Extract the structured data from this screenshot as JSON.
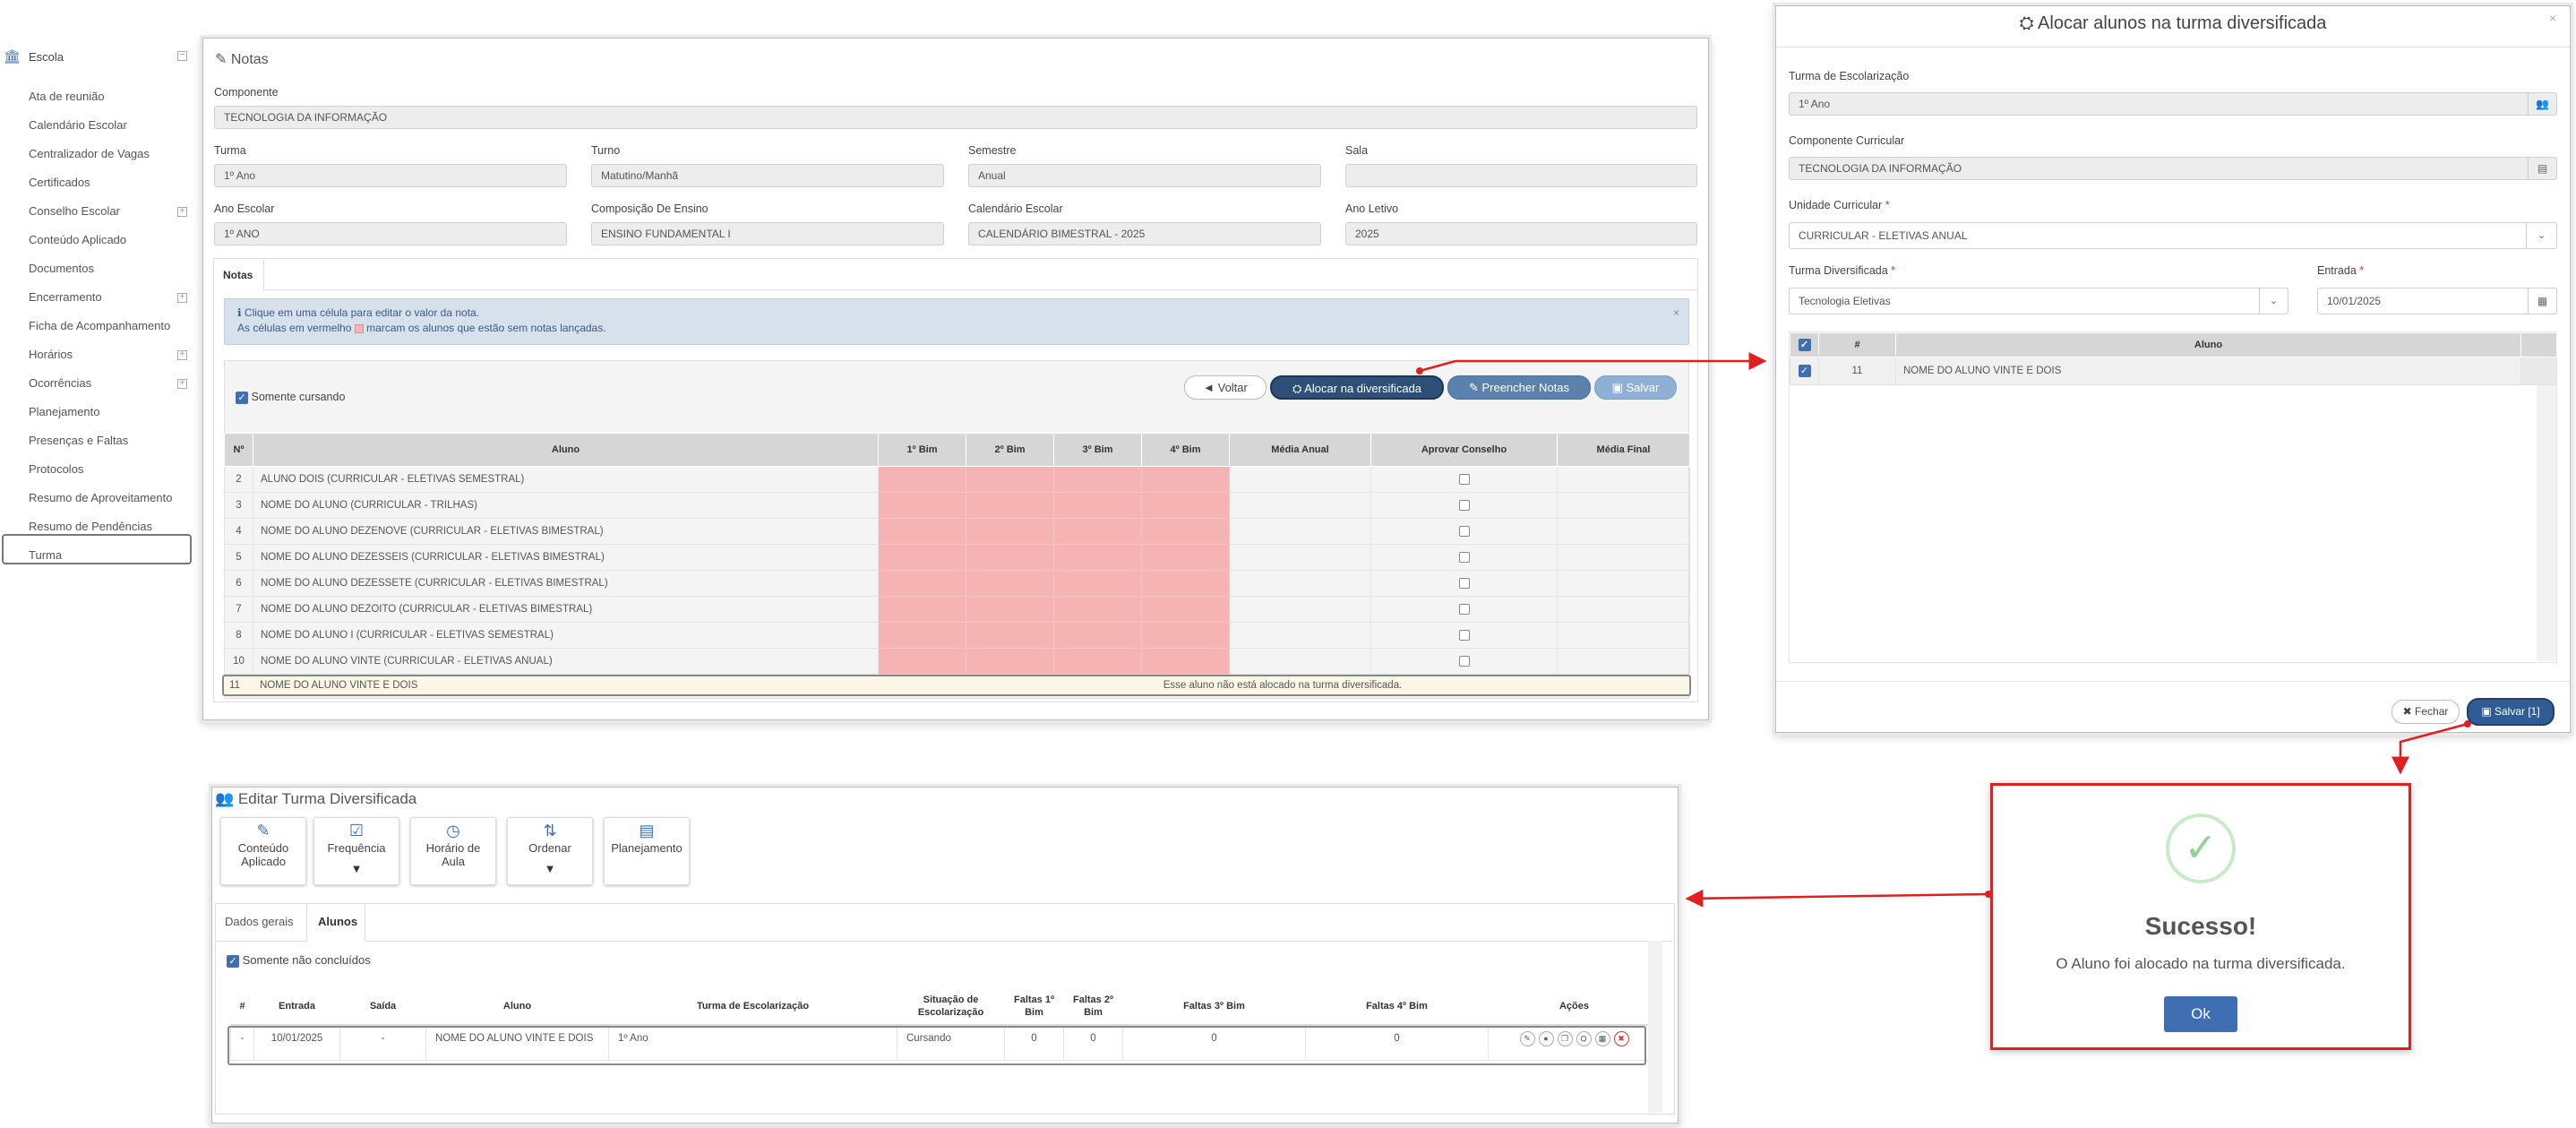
{
  "sidebar": {
    "title": "Escola",
    "items": [
      "Ata de reunião",
      "Calendário Escolar",
      "Centralizador de Vagas",
      "Certificados",
      "Conselho Escolar",
      "Conteúdo Aplicado",
      "Documentos",
      "Encerramento",
      "Ficha de Acompanhamento",
      "Horários",
      "Ocorrências",
      "Planejamento",
      "Presenças e Faltas",
      "Protocolos",
      "Resumo de Aproveitamento",
      "Resumo de Pendências",
      "Turma"
    ]
  },
  "notas": {
    "title": "Notas",
    "componente_label": "Componente",
    "componente": "TECNOLOGIA DA INFORMAÇÃO",
    "turma_label": "Turma",
    "turma": "1º Ano",
    "turno_label": "Turno",
    "turno": "Matutino/Manhã",
    "semestre_label": "Semestre",
    "semestre": "Anual",
    "sala_label": "Sala",
    "sala": "",
    "ano_escolar_label": "Ano Escolar",
    "ano_escolar": "1º ANO",
    "composicao_label": "Composição De Ensino",
    "composicao": "ENSINO FUNDAMENTAL I",
    "calendario_label": "Calendário Escolar",
    "calendario": "CALENDÁRIO BIMESTRAL - 2025",
    "ano_letivo_label": "Ano Letivo",
    "ano_letivo": "2025",
    "tab": "Notas",
    "info_line1": "Clique em uma célula para editar o valor da nota.",
    "info_line2a": "As células em vermelho",
    "info_line2b": "marcam os alunos que estão sem notas lançadas.",
    "somente_cursando": "Somente cursando",
    "btn_voltar": "Voltar",
    "btn_alocar": "Alocar na diversificada",
    "btn_preencher": "Preencher Notas",
    "btn_salvar": "Salvar",
    "headers": [
      "Nº",
      "Aluno",
      "1º Bim",
      "2º Bim",
      "3º Bim",
      "4º Bim",
      "Média Anual",
      "Aprovar Conselho",
      "Média Final"
    ],
    "rows": [
      {
        "n": "2",
        "aluno": "ALUNO DOIS (CURRICULAR - ELETIVAS SEMESTRAL)"
      },
      {
        "n": "3",
        "aluno": "NOME DO ALUNO (CURRICULAR - TRILHAS)"
      },
      {
        "n": "4",
        "aluno": "NOME DO ALUNO DEZENOVE (CURRICULAR - ELETIVAS BIMESTRAL)"
      },
      {
        "n": "5",
        "aluno": "NOME DO ALUNO DEZESSEIS (CURRICULAR - ELETIVAS BIMESTRAL)"
      },
      {
        "n": "6",
        "aluno": "NOME DO ALUNO DEZESSETE (CURRICULAR - ELETIVAS BIMESTRAL)"
      },
      {
        "n": "7",
        "aluno": "NOME DO ALUNO DEZOITO (CURRICULAR - ELETIVAS BIMESTRAL)"
      },
      {
        "n": "8",
        "aluno": "NOME DO ALUNO I (CURRICULAR - ELETIVAS SEMESTRAL)"
      },
      {
        "n": "10",
        "aluno": "NOME DO ALUNO VINTE (CURRICULAR - ELETIVAS ANUAL)"
      }
    ],
    "last_row": {
      "n": "11",
      "aluno": "NOME DO ALUNO VINTE E DOIS",
      "msg": "Esse aluno não está alocado na turma diversificada."
    }
  },
  "alocar": {
    "title": "Alocar alunos na turma diversificada",
    "turma_esc_label": "Turma de Escolarização",
    "turma_esc": "1º Ano",
    "comp_label": "Componente Curricular",
    "comp": "TECNOLOGIA DA INFORMAÇÃO",
    "unidade_label": "Unidade Curricular",
    "unidade": "CURRICULAR - ELETIVAS ANUAL",
    "turma_div_label": "Turma Diversificada",
    "turma_div": "Tecnologia Eletivas",
    "entrada_label": "Entrada",
    "entrada": "10/01/2025",
    "required_mark": "*",
    "col_num": "#",
    "col_aluno": "Aluno",
    "row_num": "11",
    "row_aluno": "NOME DO ALUNO VINTE E DOIS",
    "btn_fechar": "Fechar",
    "btn_salvar": "Salvar [1]"
  },
  "editar": {
    "title": "Editar Turma Diversificada",
    "toolbar": [
      {
        "label1": "Conteúdo",
        "label2": "Aplicado",
        "icon": "magic-wand-icon",
        "glyph": "✎"
      },
      {
        "label1": "Frequência",
        "label2": "",
        "icon": "checkbox-icon",
        "glyph": "☑"
      },
      {
        "label1": "Horário de",
        "label2": "Aula",
        "icon": "clock-icon",
        "glyph": "◷"
      },
      {
        "label1": "Ordenar",
        "label2": "",
        "icon": "sort-az-icon",
        "glyph": "⇅"
      },
      {
        "label1": "Planejamento",
        "label2": "",
        "icon": "book-icon",
        "glyph": "▤"
      }
    ],
    "tab_dados": "Dados gerais",
    "tab_alunos": "Alunos",
    "somente_nao": "Somente não concluídos",
    "headers": [
      "#",
      "Entrada",
      "Saída",
      "Aluno",
      "Turma de Escolarização",
      "Situação de Escolarização",
      "Faltas 1º Bim",
      "Faltas 2º Bim",
      "Faltas 3º Bim",
      "Faltas 4º Bim",
      "Ações"
    ],
    "row": {
      "num": "-",
      "entrada": "10/01/2025",
      "saida": "-",
      "aluno": "NOME DO ALUNO VINTE E DOIS",
      "turma": "1º Ano",
      "situacao": "Cursando",
      "f1": "0",
      "f2": "0",
      "f3": "0",
      "f4": "0"
    }
  },
  "success": {
    "title": "Sucesso!",
    "message": "O Aluno foi alocado na turma diversificada.",
    "ok": "Ok"
  },
  "colors": {
    "accent": "#3f6fb2",
    "danger": "#e02020",
    "pink": "#f6b3b3",
    "success": "#9fd89f"
  }
}
